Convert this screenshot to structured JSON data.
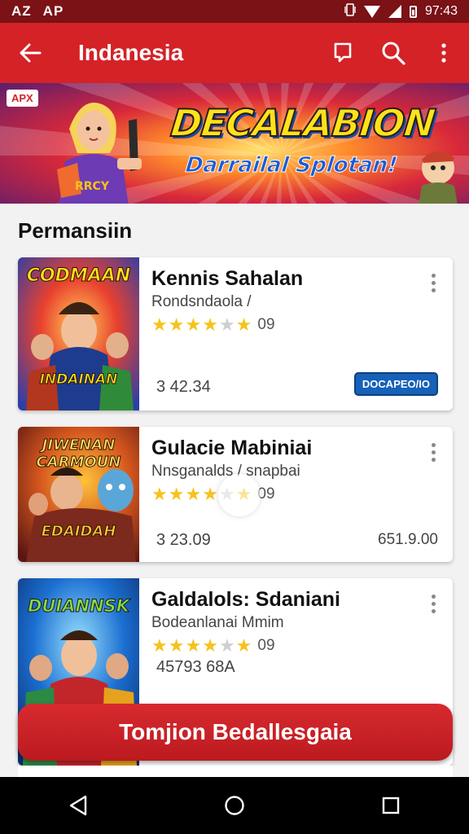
{
  "status_bar": {
    "left_labels": [
      "AZ",
      "AP"
    ],
    "time": "97:43"
  },
  "app_bar": {
    "title": "Indanesia",
    "icons": [
      "back-arrow-icon",
      "bookmark-icon",
      "search-icon",
      "more-vert-icon"
    ]
  },
  "banner": {
    "badge": "APX",
    "headline": "DECALABION",
    "subline": "Darrailal Splotan!"
  },
  "section": {
    "title": "Permansiin"
  },
  "cards": [
    {
      "name": "Kennis Sahalan",
      "developer": "Rondsndaola /",
      "rating_text": "09",
      "stars": 4.5,
      "price": "3 42.34",
      "tag": "DOCAPEO/IO",
      "thumb_title_top": "CODMAAN",
      "thumb_title_bottom": "INDAINAN",
      "thumb_colors": [
        "#e9402e",
        "#3a7bd5",
        "#f6c21c"
      ]
    },
    {
      "name": "Gulacie Mabiniai",
      "developer": "Nnsganalds / snapbai",
      "rating_text": "09",
      "stars": 4.5,
      "price": "3 23.09",
      "right_value": "651.9.00",
      "thumb_title_top": "JIWENAN CARMOUN",
      "thumb_title_bottom": "EDAIDAH",
      "thumb_colors": [
        "#a52a1a",
        "#f39b1e",
        "#3aa4d8"
      ]
    },
    {
      "name": "Galdalols: Sdaniani",
      "developer": "Bodeanlanai Mmim",
      "rating_text": "09",
      "stars": 4,
      "price": "45793 68A",
      "thumb_title_top": "DUIANNSK",
      "thumb_colors": [
        "#1b6fd1",
        "#26c06b",
        "#f6c21c"
      ]
    }
  ],
  "cta": {
    "label": "Tomjion Bedallesgaia",
    "color": "#d42227"
  },
  "nav_bar": {
    "icons": [
      "back-triangle-icon",
      "home-circle-icon",
      "recents-square-icon"
    ]
  }
}
